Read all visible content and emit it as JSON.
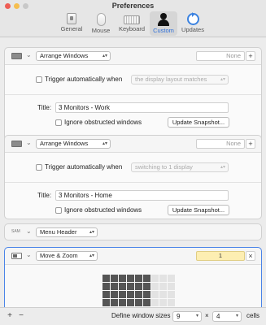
{
  "window": {
    "title": "Preferences",
    "toolbar": [
      {
        "label": "General",
        "icon": "general-icon"
      },
      {
        "label": "Mouse",
        "icon": "mouse-icon"
      },
      {
        "label": "Keyboard",
        "icon": "keyboard-icon"
      },
      {
        "label": "Custom",
        "icon": "custom-person-icon",
        "selected": true
      },
      {
        "label": "Updates",
        "icon": "updates-icon"
      }
    ]
  },
  "actions": [
    {
      "action": "Arrange Windows",
      "shortcut_placeholder": "None",
      "add_label": "+",
      "trigger_label": "Trigger automatically when",
      "trigger_condition": "the display layout matches",
      "title_label": "Title:",
      "title_value": "3 Monitors - Work",
      "ignore_label": "Ignore obstructed windows",
      "snapshot_button": "Update Snapshot..."
    },
    {
      "action": "Arrange Windows",
      "shortcut_placeholder": "None",
      "add_label": "+",
      "trigger_label": "Trigger automatically when",
      "trigger_condition": "switching to 1 display",
      "title_label": "Title:",
      "title_value": "3 Monitors - Home",
      "ignore_label": "Ignore obstructed windows",
      "snapshot_button": "Update Snapshot..."
    },
    {
      "action": "Menu Header",
      "icon_text": "SAM"
    },
    {
      "action": "Move & Zoom",
      "shortcut_value": "1",
      "close_label": "×",
      "grid": {
        "cols": 9,
        "rows": 4,
        "selected_cols": 6,
        "selected_rows": 4
      }
    }
  ],
  "bottom": {
    "add_label": "+",
    "remove_label": "−",
    "define_label": "Define window sizes using",
    "cols_value": "9",
    "times_label": "×",
    "rows_value": "4",
    "cells_label": "cells"
  }
}
